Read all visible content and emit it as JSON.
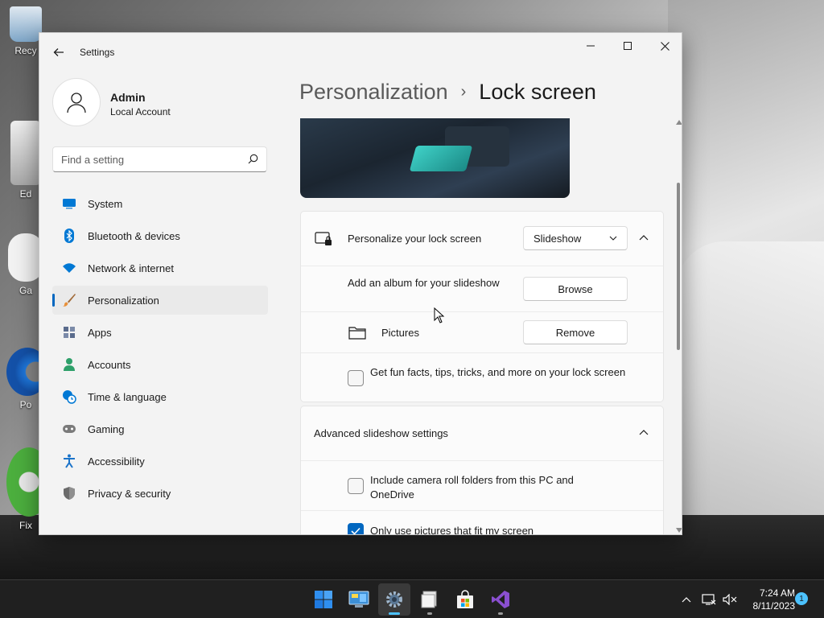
{
  "desktop": {
    "icons": [
      {
        "label": "Recy",
        "color": "#7fa7c9"
      },
      {
        "label": "Ed",
        "color": "#c9c9c9"
      },
      {
        "label": "Ga",
        "color": "#e8e8e8"
      },
      {
        "label": "Po",
        "color": "#1f7ae0"
      },
      {
        "label": "Fix ",
        "color": "#4caf3e"
      }
    ]
  },
  "window": {
    "title": "Settings",
    "controls": {
      "minimize": "minimize-icon",
      "maximize": "maximize-icon",
      "close": "close-icon"
    }
  },
  "profile": {
    "name": "Admin",
    "account_type": "Local Account"
  },
  "search": {
    "placeholder": "Find a setting",
    "value": ""
  },
  "nav": {
    "items": [
      {
        "label": "System",
        "icon": "monitor-icon",
        "color": "#0078d4"
      },
      {
        "label": "Bluetooth & devices",
        "icon": "bluetooth-icon",
        "color": "#0078d4"
      },
      {
        "label": "Network & internet",
        "icon": "wifi-icon",
        "color": "#0078d4"
      },
      {
        "label": "Personalization",
        "icon": "brush-icon",
        "color": "#e8913c",
        "active": true
      },
      {
        "label": "Apps",
        "icon": "apps-icon",
        "color": "#5a6b8c"
      },
      {
        "label": "Accounts",
        "icon": "person-icon",
        "color": "#2ea06a"
      },
      {
        "label": "Time & language",
        "icon": "globe-clock-icon",
        "color": "#0078d4"
      },
      {
        "label": "Gaming",
        "icon": "gamepad-icon",
        "color": "#7a7a7a"
      },
      {
        "label": "Accessibility",
        "icon": "accessibility-icon",
        "color": "#1a73c9"
      },
      {
        "label": "Privacy & security",
        "icon": "shield-icon",
        "color": "#6b6b6b"
      }
    ]
  },
  "breadcrumb": {
    "parent": "Personalization",
    "separator": "›",
    "current": "Lock screen"
  },
  "lock_screen": {
    "personalize_label": "Personalize your lock screen",
    "personalize_value": "Slideshow",
    "add_album_label": "Add an album for your slideshow",
    "browse_label": "Browse",
    "album_name": "Pictures",
    "remove_label": "Remove",
    "fun_facts_label": "Get fun facts, tips, tricks, and more on your lock screen",
    "fun_facts_checked": false
  },
  "advanced": {
    "title": "Advanced slideshow settings",
    "camera_roll_label": "Include camera roll folders from this PC and OneDrive",
    "camera_roll_checked": false,
    "fit_screen_label": "Only use pictures that fit my screen",
    "fit_screen_checked": true
  },
  "taskbar": {
    "apps": [
      {
        "name": "start",
        "icon": "windows-logo-icon"
      },
      {
        "name": "control-panel",
        "icon": "control-panel-icon"
      },
      {
        "name": "settings",
        "icon": "gear-icon",
        "active": true
      },
      {
        "name": "file-explorer",
        "icon": "folder-icon"
      },
      {
        "name": "microsoft-store",
        "icon": "store-icon"
      },
      {
        "name": "visual-studio",
        "icon": "visual-studio-icon"
      }
    ],
    "time": "7:24 AM",
    "date": "8/11/2023",
    "notification_count": "1"
  }
}
